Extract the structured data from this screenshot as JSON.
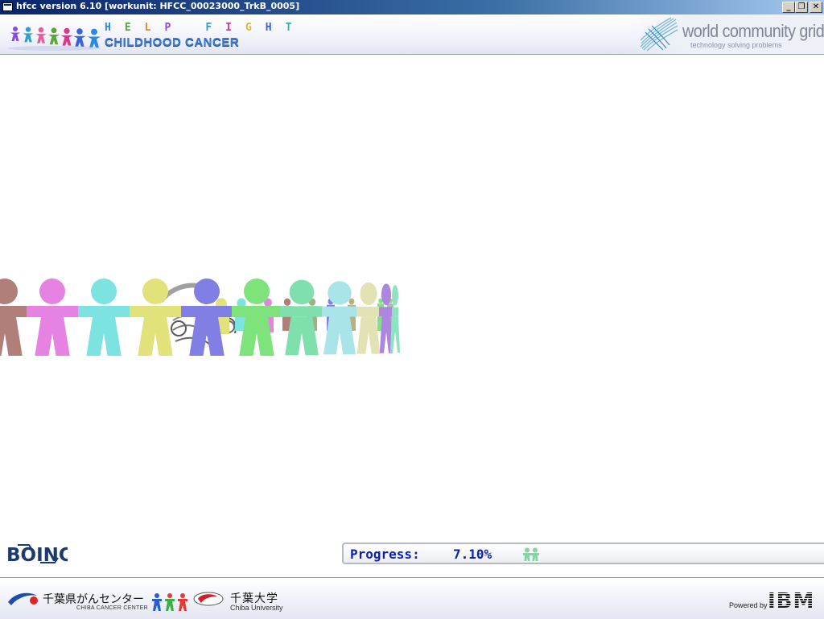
{
  "window": {
    "title": "hfcc version 6.10 [workunit: HFCC_00023000_TrkB_0005]",
    "minimize_glyph": "_",
    "maximize_glyph": "❐",
    "close_glyph": "✕"
  },
  "header": {
    "hfcc_logo": {
      "help_fight_letters": [
        "H",
        "E",
        "L",
        "P",
        "F",
        "I",
        "G",
        "H",
        "T"
      ],
      "childhood_cancer": "CHILDHOOD CANCER"
    },
    "wcg_logo": {
      "name": "world community grid.",
      "tagline": "technology solving problems"
    }
  },
  "footer": {
    "boinc_logo": "BOINC",
    "progress": {
      "label": "Progress:",
      "value": "7.10%",
      "fraction": 0.071
    },
    "chiba_cancer_center": {
      "jp": "千葉県がんセンター",
      "en": "CHIBA CANCER CENTER"
    },
    "chiba_university": {
      "jp": "千葉大学",
      "en": "Chiba University"
    },
    "powered_by": "Powered by",
    "ibm": "IBM"
  },
  "scene": {
    "figures": [
      {
        "color": "#b07f7a"
      },
      {
        "color": "#e683e2"
      },
      {
        "color": "#7de3e0"
      },
      {
        "color": "#e2e27a"
      },
      {
        "color": "#817ee4"
      },
      {
        "color": "#7fe37c"
      },
      {
        "color": "#7fe0ae"
      },
      {
        "color": "#a8e4e8"
      },
      {
        "color": "#e2e2b4"
      },
      {
        "color": "#ad86df"
      },
      {
        "color": "#8fe3c2"
      }
    ]
  },
  "colors": {
    "titlebar_start": "#0a246a",
    "titlebar_end": "#a6caf0",
    "progress_text": "#0b1fb0",
    "boinc": "#1c3a6e"
  }
}
